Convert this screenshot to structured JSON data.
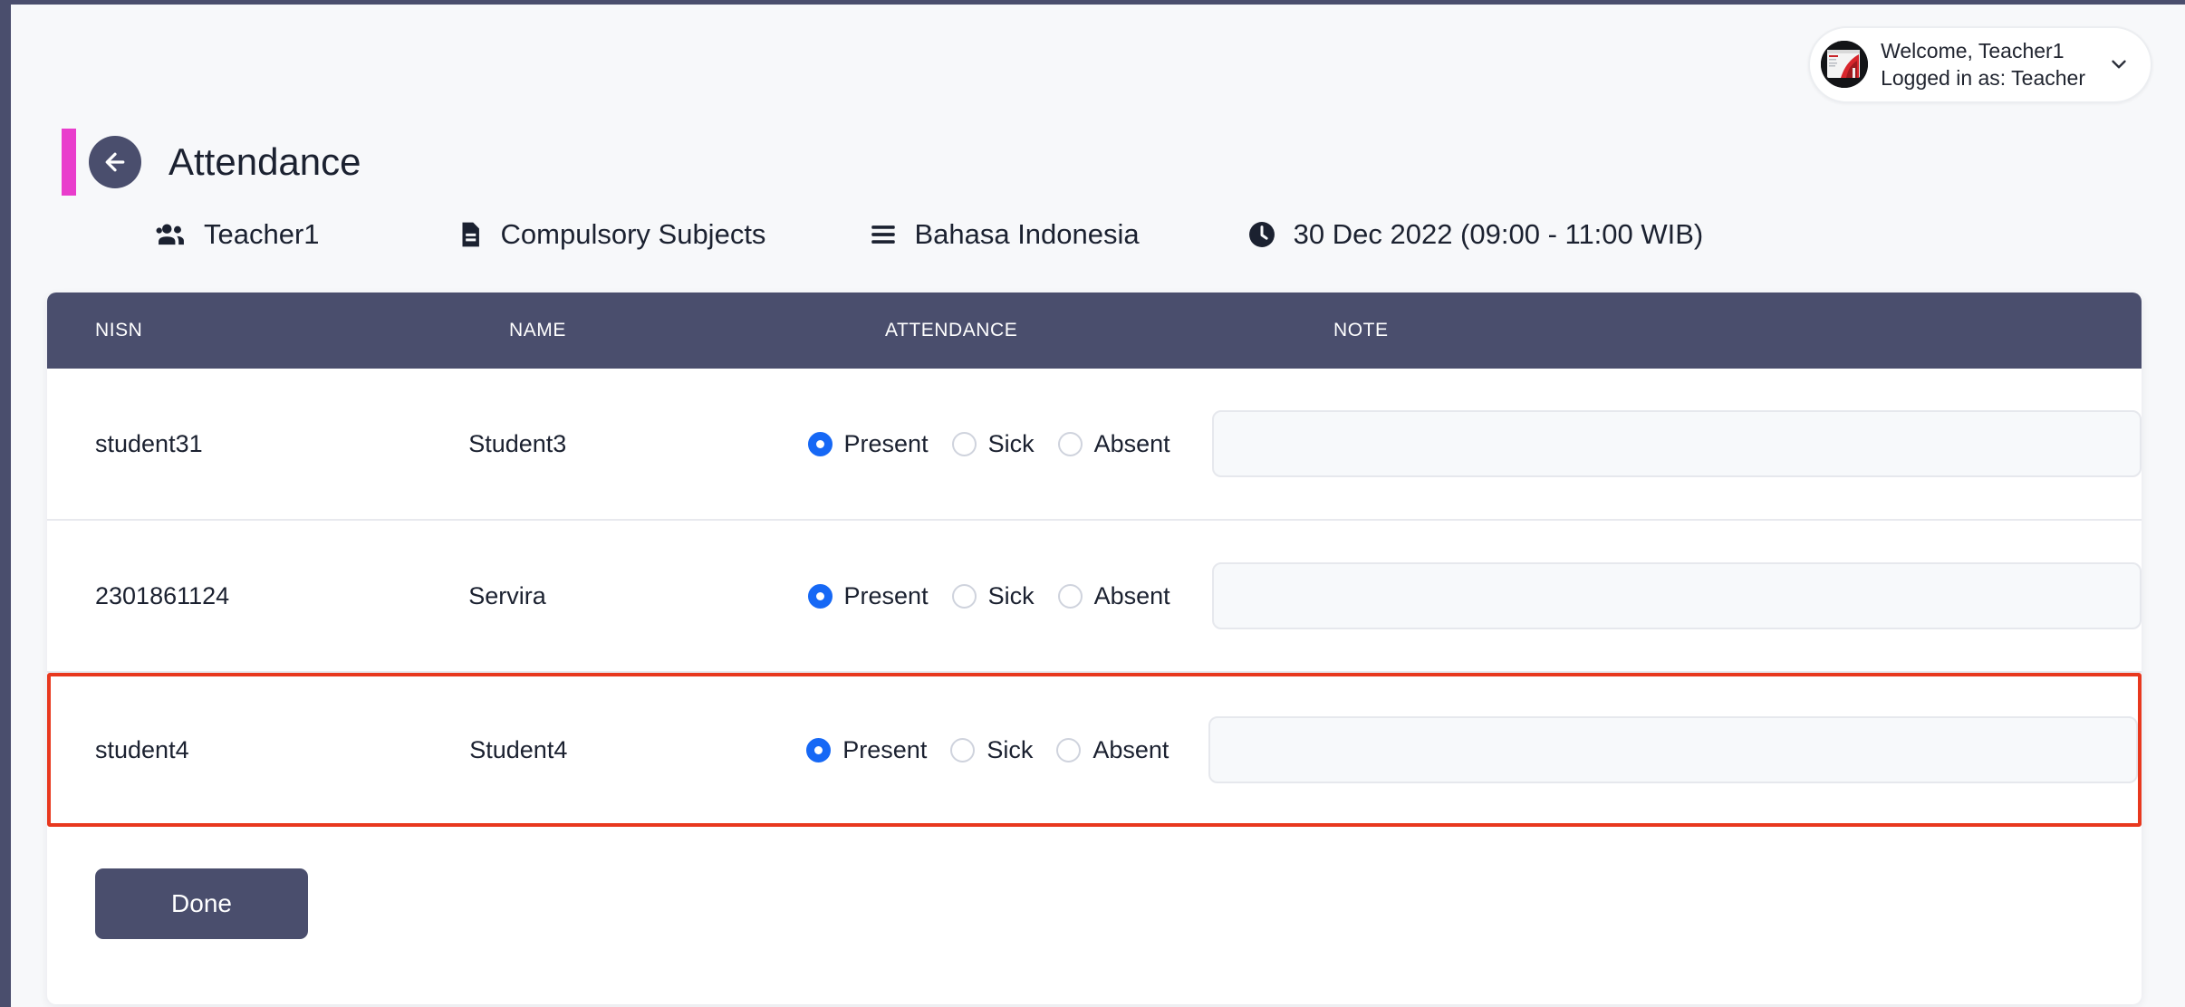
{
  "user_chip": {
    "welcome": "Welcome, Teacher1",
    "role_line": "Logged in as: Teacher",
    "avatar_name": "user-avatar",
    "chevron": "chevron-down-icon"
  },
  "header": {
    "title": "Attendance",
    "back_label": "Back",
    "accent_color": "#e93dcc",
    "dark_color": "#4a4e6d"
  },
  "meta": [
    {
      "icon": "people-icon",
      "label": "Teacher1"
    },
    {
      "icon": "document-icon",
      "label": "Compulsory Subjects"
    },
    {
      "icon": "list-icon",
      "label": "Bahasa Indonesia"
    },
    {
      "icon": "clock-icon",
      "label": "30 Dec 2022 (09:00 - 11:00 WIB)"
    }
  ],
  "table": {
    "columns": [
      "NISN",
      "NAME",
      "ATTENDANCE",
      "NOTE"
    ],
    "attendance_options": [
      "Present",
      "Sick",
      "Absent"
    ],
    "rows": [
      {
        "nisn": "student31",
        "name": "Student3",
        "attendance": "Present",
        "note": "",
        "note_placeholder": "",
        "highlighted": false
      },
      {
        "nisn": "2301861124",
        "name": "Servira",
        "attendance": "Present",
        "note": "",
        "note_placeholder": "",
        "highlighted": false
      },
      {
        "nisn": "student4",
        "name": "Student4",
        "attendance": "Present",
        "note": "",
        "note_placeholder": "",
        "highlighted": true
      }
    ]
  },
  "footer": {
    "done_label": "Done"
  },
  "colors": {
    "header_dark": "#4a4e6d",
    "accent_magenta": "#e93dcc",
    "radio_blue": "#1668f5",
    "highlight_red": "#e8381e",
    "page_bg": "#f7f8fa"
  }
}
